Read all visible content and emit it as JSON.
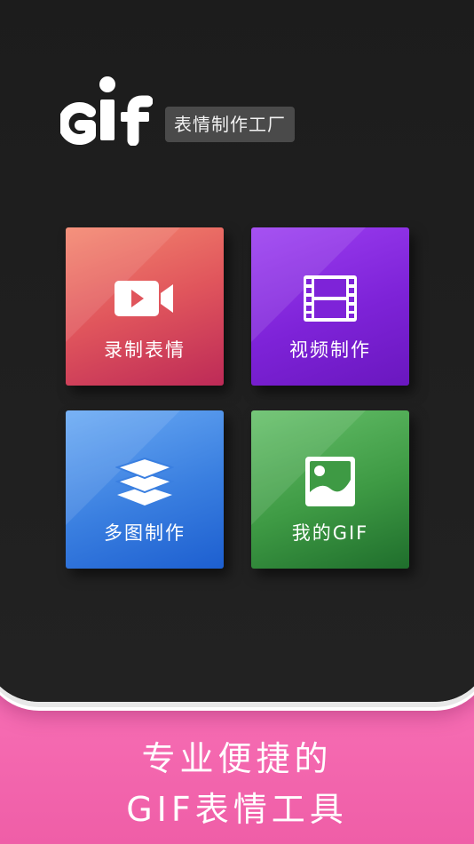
{
  "app": {
    "logo_text": "GIF",
    "subtitle": "表情制作工厂"
  },
  "tiles": [
    {
      "id": "record",
      "label": "录制表情",
      "icon": "video-camera-icon",
      "color": "#e0555c"
    },
    {
      "id": "video",
      "label": "视频制作",
      "icon": "film-strip-icon",
      "color": "#7e23d8"
    },
    {
      "id": "multi",
      "label": "多图制作",
      "icon": "layers-icon",
      "color": "#3a7fe0"
    },
    {
      "id": "mine",
      "label": "我的GIF",
      "icon": "image-icon",
      "color": "#3e9a44"
    }
  ],
  "slogan": {
    "line1": "专业便捷的",
    "line2": "GIF表情工具"
  },
  "colors": {
    "background_pink": "#ff86c9",
    "phone_dark": "#1f1f1f",
    "subtitle_bg": "#4a4a4a"
  }
}
